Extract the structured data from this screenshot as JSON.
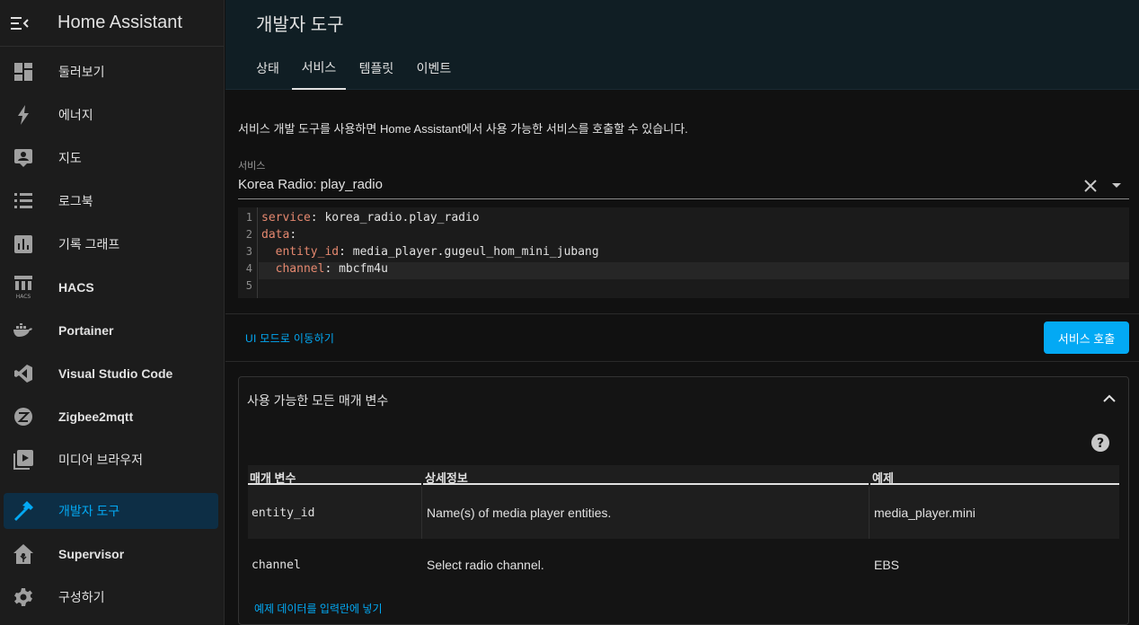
{
  "app": {
    "title": "Home Assistant"
  },
  "sidebar": {
    "items": [
      {
        "label": "둘러보기",
        "icon": "dashboard-icon",
        "bold": false
      },
      {
        "label": "에너지",
        "icon": "lightning-bolt-icon",
        "bold": false
      },
      {
        "label": "지도",
        "icon": "map-account-icon",
        "bold": false
      },
      {
        "label": "로그북",
        "icon": "logbook-list-icon",
        "bold": false
      },
      {
        "label": "기록 그래프",
        "icon": "chart-box-icon",
        "bold": false
      },
      {
        "label": "HACS",
        "icon": "hacs-icon",
        "bold": true
      },
      {
        "label": "Portainer",
        "icon": "docker-icon",
        "bold": true
      },
      {
        "label": "Visual Studio Code",
        "icon": "vscode-icon",
        "bold": true
      },
      {
        "label": "Zigbee2mqtt",
        "icon": "zigbee-icon",
        "bold": true
      },
      {
        "label": "미디어 브라우저",
        "icon": "play-box-multiple-icon",
        "bold": false
      },
      {
        "label": "개발자 도구",
        "icon": "hammer-icon",
        "bold": false,
        "active": true
      },
      {
        "label": "Supervisor",
        "icon": "home-assistant-icon",
        "bold": true
      },
      {
        "label": "구성하기",
        "icon": "cog-icon",
        "bold": false
      }
    ]
  },
  "header": {
    "title": "개발자 도구",
    "tabs": [
      {
        "label": "상태"
      },
      {
        "label": "서비스",
        "active": true
      },
      {
        "label": "템플릿"
      },
      {
        "label": "이벤트"
      }
    ]
  },
  "main": {
    "description": "서비스 개발 도구를 사용하면 Home Assistant에서 사용 가능한 서비스를 호출할 수 있습니다.",
    "service_field": {
      "label": "서비스",
      "value": "Korea Radio: play_radio"
    },
    "editor": {
      "lines": [
        {
          "num": "1",
          "key": "service",
          "rest": " korea_radio.play_radio",
          "indent": ""
        },
        {
          "num": "2",
          "key": "data",
          "rest": "",
          "indent": ""
        },
        {
          "num": "3",
          "key": "entity_id",
          "rest": " media_player.gugeul_hom_mini_jubang",
          "indent": "  "
        },
        {
          "num": "4",
          "key": "channel",
          "rest": " mbcfm4u",
          "indent": "  "
        },
        {
          "num": "5",
          "key": "",
          "rest": "",
          "indent": ""
        }
      ]
    },
    "ui_mode_link": "UI 모드로 이동하기",
    "call_button": "서비스 호출",
    "params": {
      "title": "사용 가능한 모든 매개 변수",
      "headers": [
        "매개 변수",
        "상세정보",
        "예제"
      ],
      "rows": [
        {
          "param": "entity_id",
          "detail": "Name(s) of media player entities.",
          "example": "media_player.mini"
        },
        {
          "param": "channel",
          "detail": "Select radio channel.",
          "example": "EBS"
        }
      ],
      "fill_link": "예제 데이터를 입력란에 넣기"
    }
  },
  "colors": {
    "accent": "#03a9f4",
    "yaml_key": "#e5886f",
    "header_bg": "#101e24",
    "active_item_bg": "#0d2e45"
  }
}
